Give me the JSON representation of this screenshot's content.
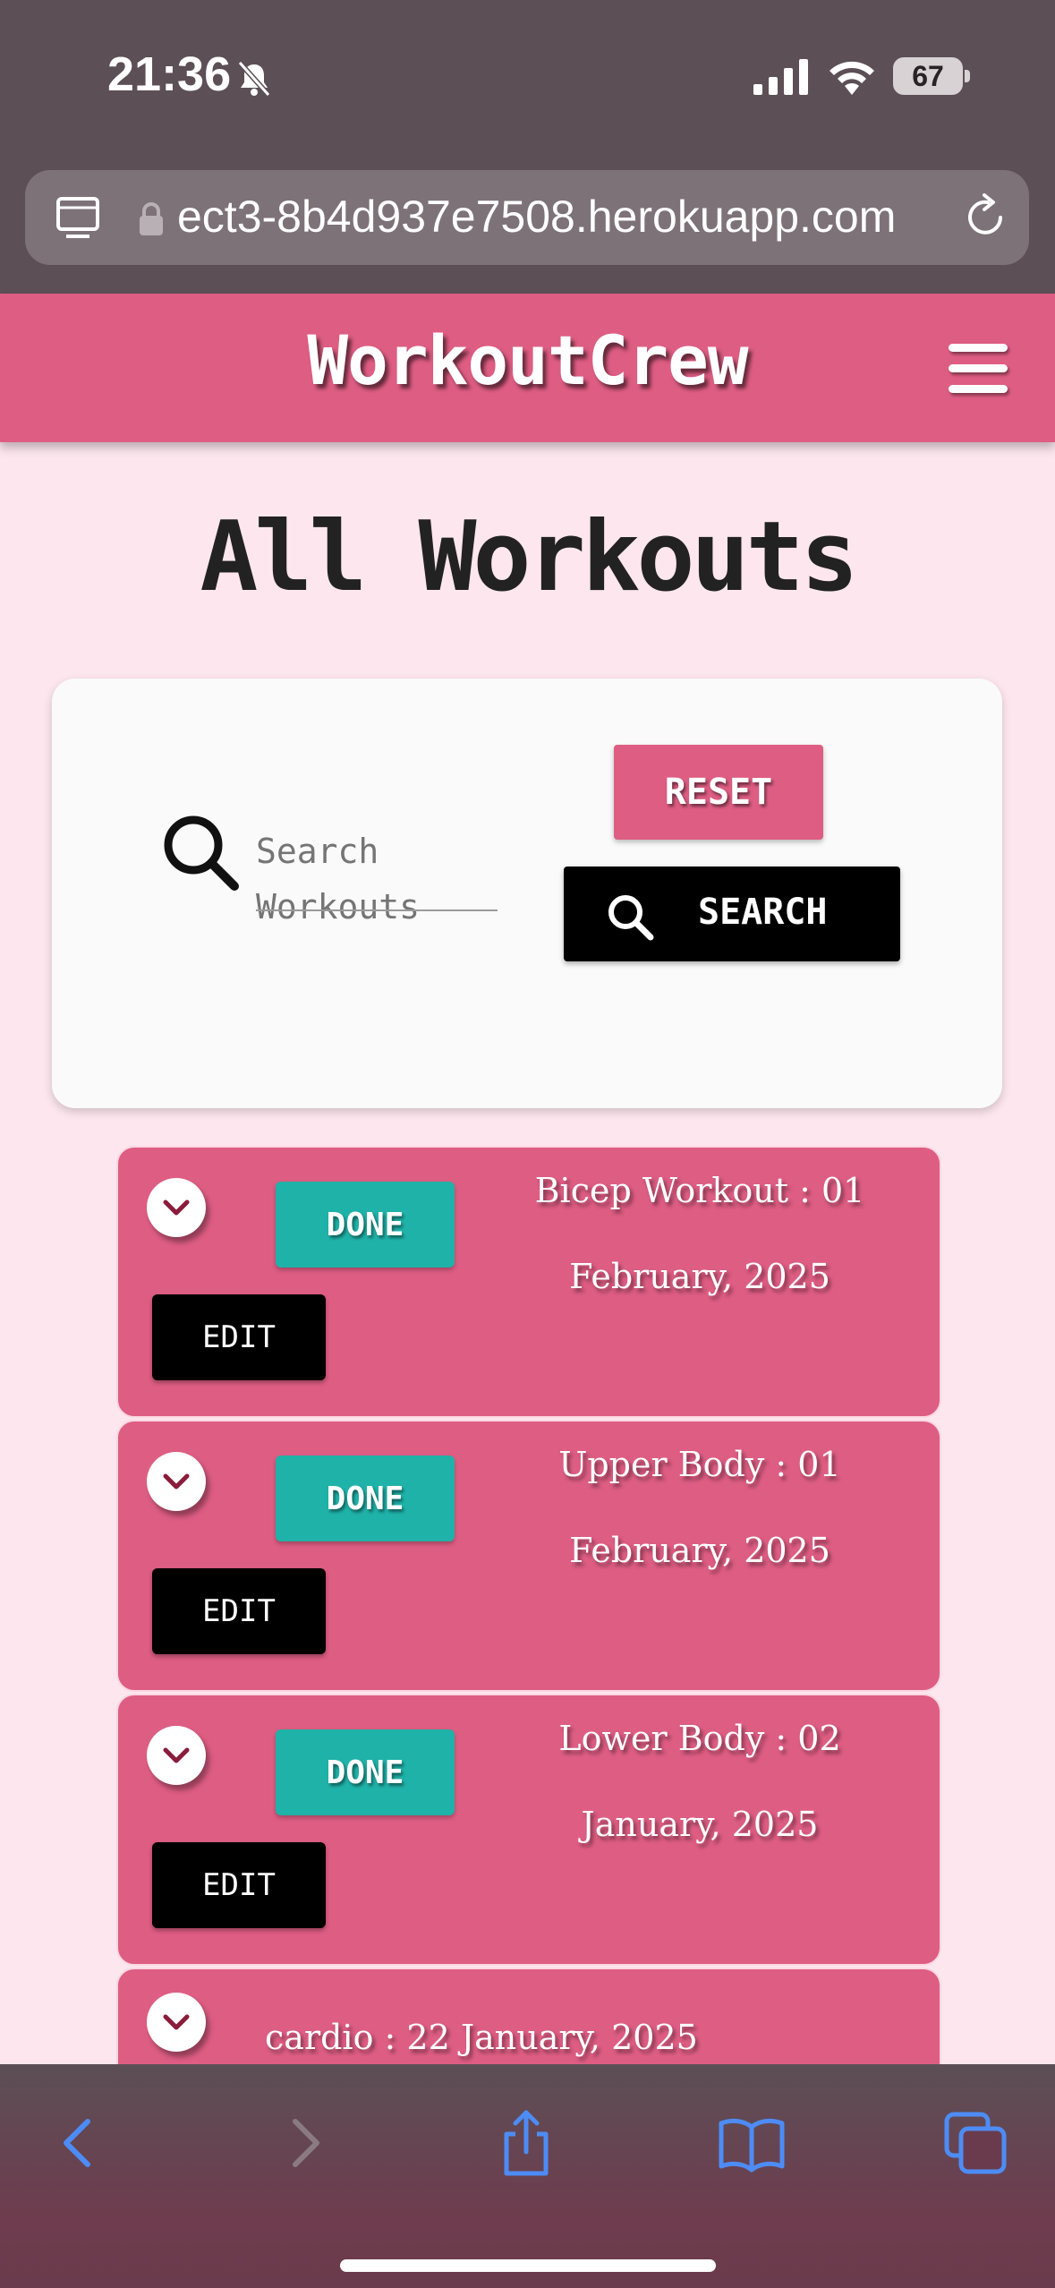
{
  "status_bar": {
    "time": "21:36",
    "battery": "67",
    "icons": [
      "bell-slash-icon",
      "signal-icon",
      "wifi-icon",
      "battery-icon"
    ]
  },
  "browser": {
    "url": "ect3-8b4d937e7508.herokuapp.com",
    "icons": [
      "tabs-icon",
      "lock-icon",
      "reload-icon"
    ]
  },
  "header": {
    "brand": "WorkoutCrew",
    "menu_icon": "hamburger-icon",
    "background": "#de5d83"
  },
  "page": {
    "title": "All Workouts",
    "background": "#fde6ee"
  },
  "search": {
    "placeholder": "Search Workouts",
    "reset_label": "RESET",
    "search_label": "SEARCH",
    "icon": "search-icon"
  },
  "workouts": [
    {
      "name": "Bicep Workout",
      "date": ": 01 February, 2025",
      "line1": "Bicep Workout  : 01",
      "line2": "February, 2025",
      "done_label": "DONE",
      "edit_label": "EDIT"
    },
    {
      "name": "Upper Body",
      "date": ": 01 February, 2025",
      "line1": "Upper Body  : 01",
      "line2": "February, 2025",
      "done_label": "DONE",
      "edit_label": "EDIT"
    },
    {
      "name": "Lower Body",
      "date": ": 02 January, 2025",
      "line1": "Lower Body  : 02",
      "line2": "January, 2025",
      "done_label": "DONE",
      "edit_label": "EDIT"
    },
    {
      "name": "cardio",
      "date": ": 22 January, 2025",
      "line1": "cardio  : 22 January, 2025"
    }
  ],
  "colors": {
    "card": "#de5d83",
    "done": "#1fb2a8",
    "edit": "#000000"
  },
  "toolbar": {
    "icons": [
      "back-icon",
      "forward-icon",
      "share-icon",
      "bookmarks-icon",
      "tabs-overview-icon"
    ]
  }
}
